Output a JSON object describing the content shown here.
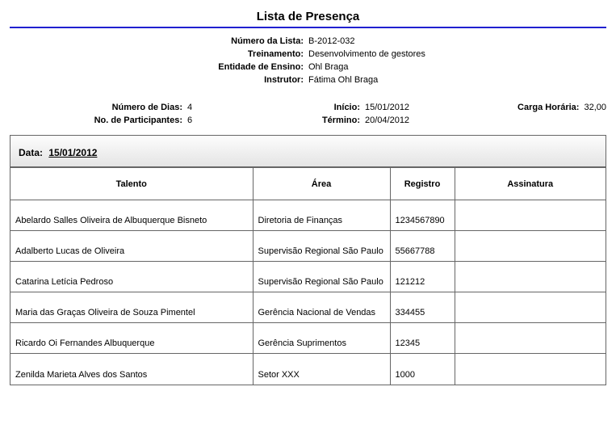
{
  "title": "Lista de Presença",
  "header": {
    "numero_lista_label": "Número da Lista:",
    "numero_lista": "B-2012-032",
    "treinamento_label": "Treinamento:",
    "treinamento": "Desenvolvimento de gestores",
    "entidade_label": "Entidade de Ensino:",
    "entidade": "Ohl Braga",
    "instrutor_label": "Instrutor:",
    "instrutor": "Fátima Ohl Braga"
  },
  "summary": {
    "numero_dias_label": "Número de Dias:",
    "numero_dias": "4",
    "participantes_label": "No. de Participantes:",
    "participantes": "6",
    "inicio_label": "Início:",
    "inicio": "15/01/2012",
    "termino_label": "Término:",
    "termino": "20/04/2012",
    "carga_label": "Carga Horária:",
    "carga": "32,00"
  },
  "attendance": {
    "data_label": "Data:",
    "data": "15/01/2012",
    "columns": {
      "talento": "Talento",
      "area": "Área",
      "registro": "Registro",
      "assinatura": "Assinatura"
    },
    "rows": [
      {
        "talento": "Abelardo Salles Oliveira de Albuquerque Bisneto",
        "area": "Diretoria de Finanças",
        "registro": "1234567890",
        "assinatura": ""
      },
      {
        "talento": "Adalberto Lucas de Oliveira",
        "area": "Supervisão Regional São Paulo",
        "registro": "55667788",
        "assinatura": ""
      },
      {
        "talento": "Catarina Letícia Pedroso",
        "area": "Supervisão Regional São Paulo",
        "registro": "121212",
        "assinatura": ""
      },
      {
        "talento": "Maria das Graças Oliveira de Souza Pimentel",
        "area": "Gerência Nacional de Vendas",
        "registro": "334455",
        "assinatura": ""
      },
      {
        "talento": "Ricardo Oi Fernandes Albuquerque",
        "area": "Gerência Suprimentos",
        "registro": "12345",
        "assinatura": ""
      },
      {
        "talento": "Zenilda Marieta Alves dos Santos",
        "area": "Setor XXX",
        "registro": "1000",
        "assinatura": ""
      }
    ]
  }
}
